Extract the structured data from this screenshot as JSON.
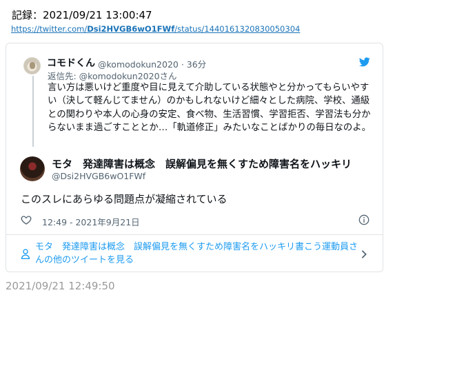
{
  "record": {
    "label": "記録：2021/09/21 13:00:47"
  },
  "source_url": {
    "prefix": "https://twitter.com/",
    "user": "Dsi2HVGB6wO1FWf",
    "suffix": "/status/1440161320830050304"
  },
  "reply": {
    "name": "コモドくん",
    "handle_time": "@komodokun2020 · 36分",
    "replying_to": "返信先: @komodokun2020さん",
    "text": "言い方は悪いけど重度や目に見えて介助している状態やと分かってもらいやすい（決して軽んじてません）のかもしれないけど細々とした病院、学校、通級との関わりや本人の心身の安定、食べ物、生活習慣、学習拒否、学習法も分からないまま過ごすこととか…「軌道修正」みたいなことばかりの毎日なのよ。"
  },
  "tweet": {
    "author_name": "モタ　発達障害は概念　誤解偏見を無くすため障害名をハッキリ",
    "author_handle": "@Dsi2HVGB6wO1FWf",
    "text": "このスレにあらゆる問題点が凝縮されている",
    "timestamp": "12:49 - 2021年9月21日"
  },
  "more_tweets": {
    "label": "モタ　発達障害は概念　誤解偏見を無くすため障害名をハッキリ書こう運動員さんの他のツイートを見る"
  },
  "footer": {
    "time": "2021/09/21 12:49:50"
  },
  "icons": {
    "bird": "twitter-bird-icon",
    "heart": "heart-icon",
    "info": "info-icon",
    "person": "person-icon",
    "chevron": "chevron-right-icon"
  },
  "colors": {
    "link": "#1a73b8",
    "twitter_blue": "#1d9bf0",
    "muted": "#536471",
    "footer": "#9a9a9a"
  }
}
